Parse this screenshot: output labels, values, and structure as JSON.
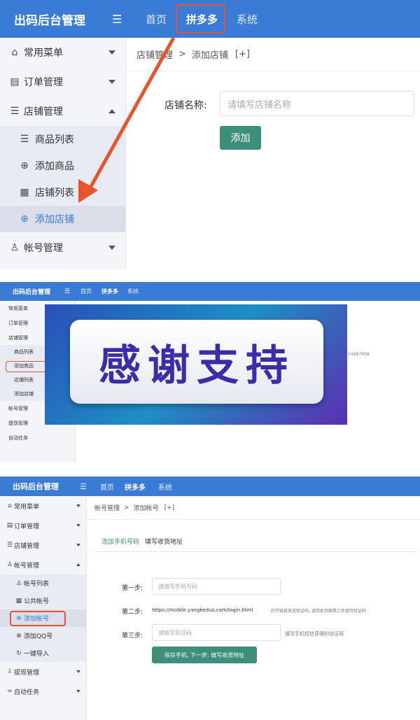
{
  "panel1": {
    "brand": "出码后台管理",
    "menu_toggle_glyph": "☰",
    "nav": [
      "首页",
      "拼多多",
      "系统"
    ],
    "sidebar": {
      "groups": [
        {
          "label": "常用菜单",
          "icon": "home-icon"
        },
        {
          "label": "订单管理",
          "icon": "database-icon"
        },
        {
          "label": "店铺管理",
          "icon": "list-icon"
        }
      ],
      "sub_items": [
        {
          "label": "商品列表",
          "icon": "list-icon"
        },
        {
          "label": "添加商品",
          "icon": "plus-circle-icon"
        },
        {
          "label": "店铺列表",
          "icon": "grid-icon"
        },
        {
          "label": "添加店铺",
          "icon": "plus-circle-icon"
        }
      ],
      "last_group": {
        "label": "帐号管理",
        "icon": "user-icon"
      }
    },
    "breadcrumb": {
      "parent": "店铺管理",
      "sep": ">",
      "current": "添加店铺",
      "extra": "[+]"
    },
    "form": {
      "label": "店铺名称:",
      "placeholder": "请填写店铺名称",
      "button": "添加"
    }
  },
  "panel2": {
    "brand": "出码后台管理",
    "nav": [
      "首页",
      "拼多多",
      "系统"
    ],
    "sidebar": [
      {
        "label": "常用菜单"
      },
      {
        "label": "订单管理"
      },
      {
        "label": "店铺管理"
      },
      {
        "label": "商品列表"
      },
      {
        "label": "添加商品"
      },
      {
        "label": "店铺列表"
      },
      {
        "label": "添加店铺"
      },
      {
        "label": "帐号管理"
      },
      {
        "label": "提现管理"
      },
      {
        "label": "自动任务"
      }
    ],
    "banner_text": "感谢支持",
    "side_number": "+3497908"
  },
  "panel3": {
    "brand": "出码后台管理",
    "nav": [
      "首页",
      "拼多多",
      "系统"
    ],
    "sidebar": {
      "groups": [
        {
          "label": "常用菜单"
        },
        {
          "label": "订单管理"
        },
        {
          "label": "店铺管理"
        },
        {
          "label": "帐号管理"
        }
      ],
      "sub_items": [
        {
          "label": "帐号列表"
        },
        {
          "label": "公共帐号"
        },
        {
          "label": "添加帐号"
        },
        {
          "label": "添加QQ号"
        },
        {
          "label": "一键导入"
        }
      ],
      "tail_groups": [
        {
          "label": "提现管理"
        },
        {
          "label": "自动任务"
        }
      ]
    },
    "breadcrumb": {
      "parent": "帐号管理",
      "sep": ">",
      "current": "添加帐号",
      "extra": "[+]"
    },
    "tabs": [
      "添加手机号码",
      "填写收货地址"
    ],
    "step1": {
      "label": "第一步:",
      "placeholder": "请填写手机号码"
    },
    "step2": {
      "label": "第二步:",
      "url": "https://mobile.yangkeduo.com/login.html",
      "hint": "打开链接发送验证码, 返回本页面第三步填写验证码"
    },
    "step3": {
      "label": "第三步:",
      "placeholder": "请填写验证码",
      "hint": "填写手机短信获得的验证码"
    },
    "submit": "保存手机, 下一步: 填写收货地址"
  }
}
